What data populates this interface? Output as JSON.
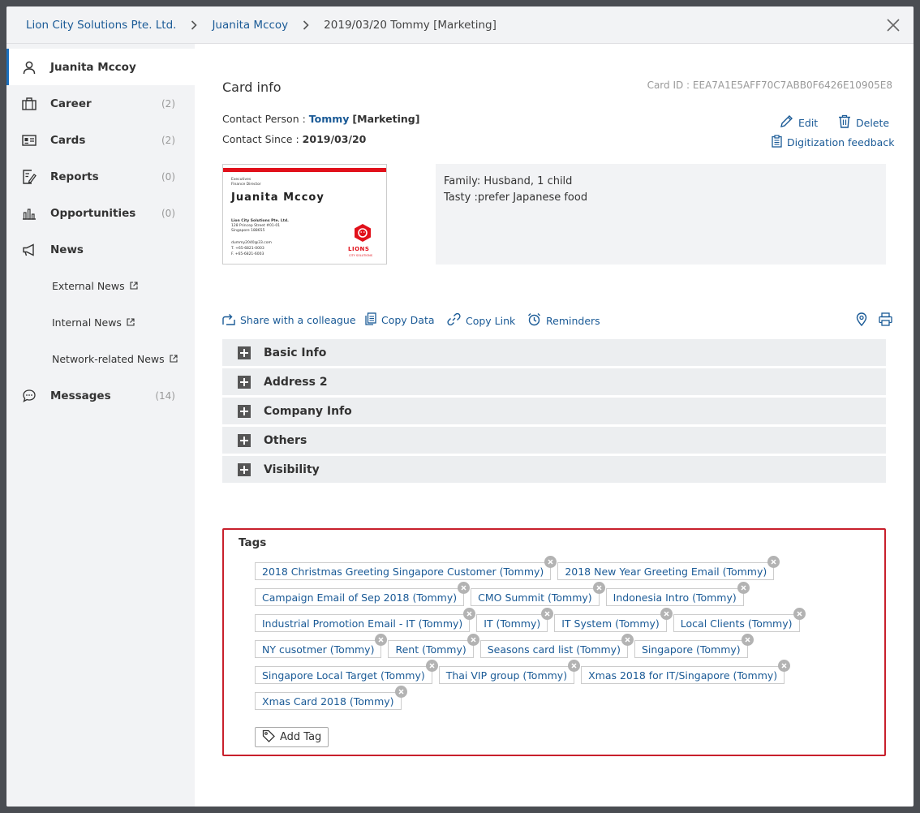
{
  "breadcrumb": {
    "items": [
      {
        "label": "Lion City Solutions Pte. Ltd."
      },
      {
        "label": "Juanita Mccoy"
      },
      {
        "label": "2019/03/20 Tommy [Marketing]"
      }
    ]
  },
  "sidebar": {
    "items": [
      {
        "label": "Juanita Mccoy",
        "count": "",
        "icon": "person-icon"
      },
      {
        "label": "Career",
        "count": "(2)",
        "icon": "briefcase-icon"
      },
      {
        "label": "Cards",
        "count": "(2)",
        "icon": "id-card-icon"
      },
      {
        "label": "Reports",
        "count": "(0)",
        "icon": "report-edit-icon"
      },
      {
        "label": "Opportunities",
        "count": "(0)",
        "icon": "bar-chart-icon"
      },
      {
        "label": "News",
        "count": "",
        "icon": "megaphone-icon"
      },
      {
        "label": "Messages",
        "count": "(14)",
        "icon": "chat-bubble-icon"
      }
    ],
    "news_items": [
      {
        "label": "External News"
      },
      {
        "label": "Internal News"
      },
      {
        "label": "Network-related News"
      }
    ]
  },
  "card": {
    "title": "Card info",
    "card_id": "Card ID : EEA7A1E5AFF70C7ABB0F6426E10905E8",
    "contact_person_label": "Contact Person : ",
    "contact_person_name": "Tommy",
    "contact_person_dept": "[Marketing]",
    "contact_since_label": "Contact Since : ",
    "contact_since_value": "2019/03/20",
    "edit_label": "Edit",
    "delete_label": "Delete",
    "feedback_label": "Digitization feedback",
    "notes_line1": "Family: Husband, 1 child",
    "notes_line2": "Tasty :prefer Japanese food"
  },
  "business_card": {
    "title_line1": "Executives",
    "title_line2": "Finance Director",
    "name": "Juanita Mccoy",
    "company": "Lion City Solutions Pte. Ltd.",
    "address1": "128 Princep Street #01-01",
    "address2": "Singapore 188655",
    "email": "dummy2040@33.com",
    "tel": "T. +65-6821-0003",
    "fax": "F. +65-6821-6003",
    "logo_text": "LIONS",
    "logo_sub": "CITY SOLUTIONS",
    "accent_color": "#e1101a"
  },
  "toolbar": {
    "share": "Share with a colleague",
    "copy_data": "Copy Data",
    "copy_link": "Copy Link",
    "reminders": "Reminders"
  },
  "sections": [
    {
      "title": "Basic Info"
    },
    {
      "title": "Address 2"
    },
    {
      "title": "Company Info"
    },
    {
      "title": "Others"
    },
    {
      "title": "Visibility"
    }
  ],
  "tags": {
    "title": "Tags",
    "rows": [
      [
        "2018 Christmas Greeting Singapore Customer (Tommy)",
        "2018 New Year Greeting Email (Tommy)"
      ],
      [
        "Campaign Email of Sep 2018 (Tommy)",
        "CMO Summit (Tommy)",
        "Indonesia Intro (Tommy)"
      ],
      [
        "Industrial Promotion Email - IT (Tommy)",
        "IT (Tommy)",
        "IT System (Tommy)",
        "Local Clients (Tommy)"
      ],
      [
        "NY cusotmer (Tommy)",
        "Rent (Tommy)",
        "Seasons card list (Tommy)",
        "Singapore (Tommy)"
      ],
      [
        "Singapore Local Target (Tommy)",
        "Thai VIP group (Tommy)",
        "Xmas 2018 for IT/Singapore (Tommy)"
      ],
      [
        "Xmas Card 2018 (Tommy)"
      ]
    ],
    "add_label": "Add Tag",
    "border_color": "#c8202c"
  },
  "colors": {
    "link": "#1a5a96",
    "accent": "#1a6fbd",
    "sidebar_bg": "#f2f3f5",
    "section_bg": "#eceef0"
  }
}
